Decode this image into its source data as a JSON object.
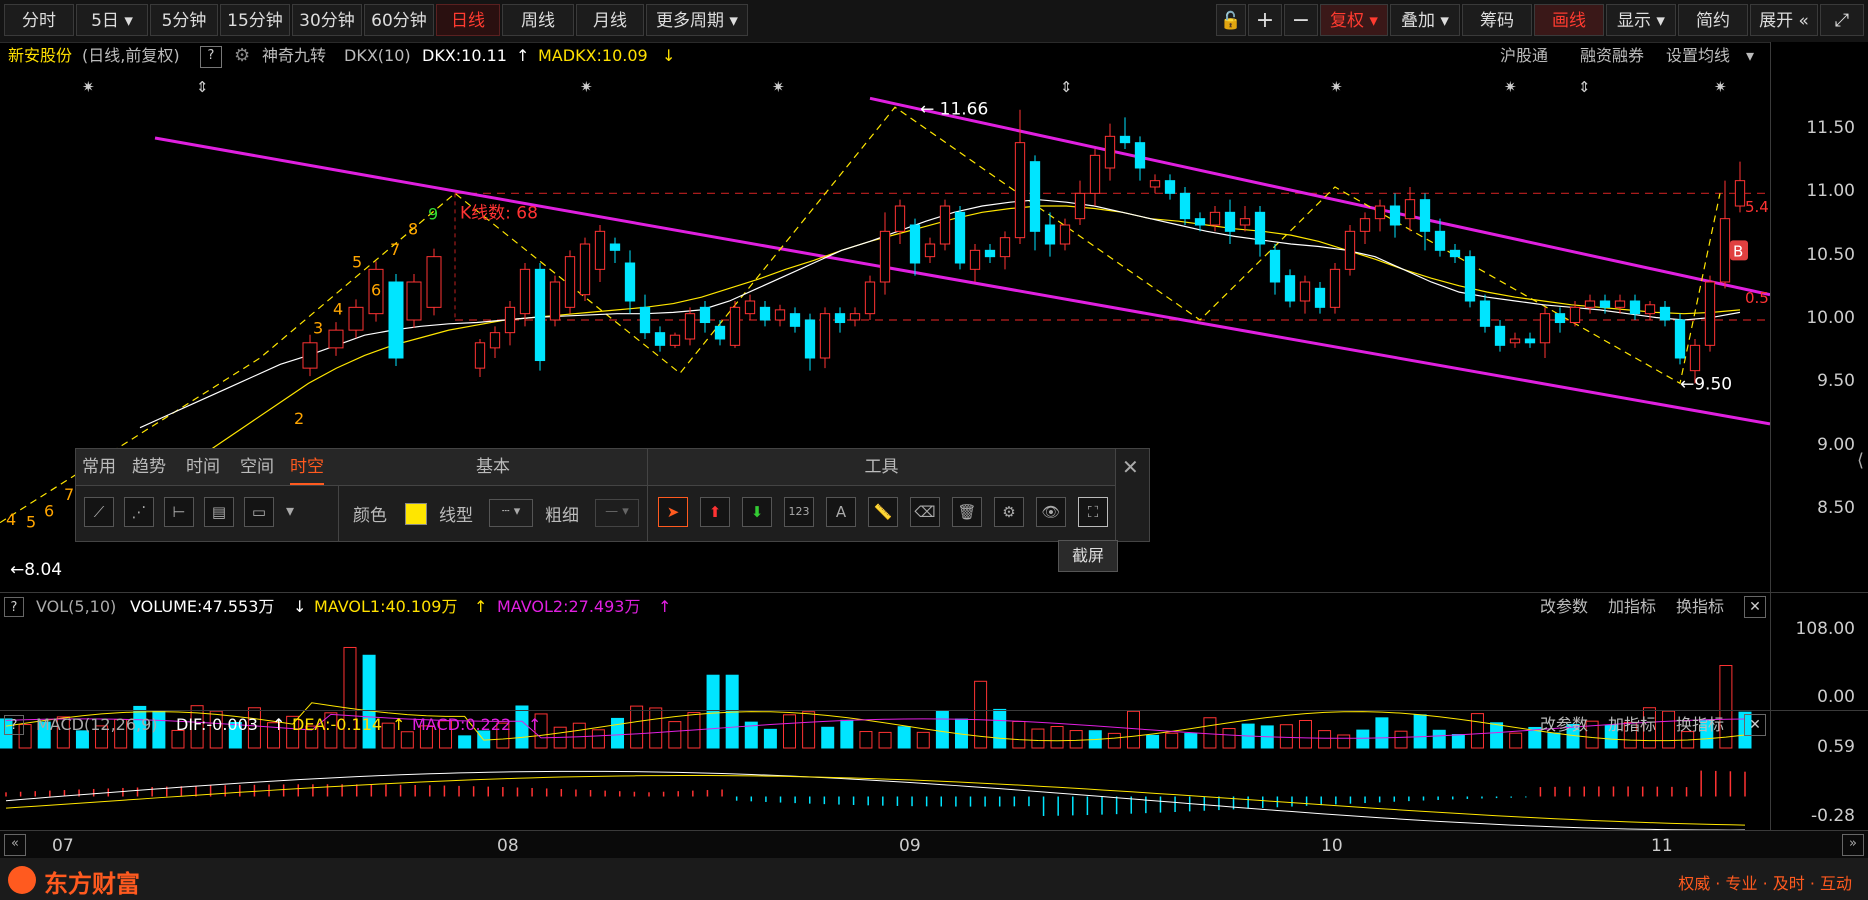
{
  "toolbar": {
    "buttons": [
      "分时",
      "5日",
      "5分钟",
      "15分钟",
      "30分钟",
      "60分钟",
      "日线",
      "周线",
      "月线",
      "更多周期"
    ],
    "right": [
      "复权",
      "叠加",
      "筹码",
      "画线",
      "显示",
      "简约",
      "展开"
    ]
  },
  "info": {
    "stock": "新安股份",
    "mode": "(日线,前复权)",
    "help": "?",
    "indicator": "神奇九转",
    "dkx_name": "DKX(10)",
    "dkx": "DKX:10.11",
    "madkx": "MADKX:10.09",
    "links": [
      "沪股通",
      "融资融券",
      "设置均线"
    ]
  },
  "chart_labels": {
    "high": "11.66",
    "low": "9.50",
    "low_left": "8.04",
    "kcount": "K线数: 68",
    "right_marker1": "5.4",
    "right_marker2": "0.5",
    "b_marker": "B"
  },
  "nine_turn": [
    "3",
    "4",
    "5",
    "6",
    "7",
    "8",
    "9"
  ],
  "nine_turn_left": [
    "4",
    "5",
    "6",
    "7",
    "2"
  ],
  "vol_header": {
    "name": "VOL(5,10)",
    "volume": "VOLUME:47.553万",
    "mavol1": "MAVOL1:40.109万",
    "mavol2": "MAVOL2:27.493万",
    "actions": [
      "改参数",
      "加指标",
      "换指标"
    ]
  },
  "macd_header": {
    "name": "MACD(12,26,9)",
    "dif": "DIF:-0.003",
    "dea": "DEA:-0.114",
    "macd": "MACD:0.222",
    "actions": [
      "改参数",
      "加指标",
      "换指标"
    ]
  },
  "tool_panel": {
    "tabs": [
      "常用",
      "趋势",
      "时间",
      "空间",
      "时空"
    ],
    "basic_title": "基本",
    "color_label": "颜色",
    "line_label": "线型",
    "width_label": "粗细",
    "tools_title": "工具",
    "tooltip": "截屏"
  },
  "footer": {
    "brand": "东方财富",
    "slogan": "权威 · 专业 · 及时 · 互动"
  },
  "colors": {
    "up": "#ff3333",
    "down": "#00e5ff",
    "ma1": "#ffffff",
    "ma2": "#ffe600",
    "trend": "#e020e0",
    "accent": "#ff3b30"
  },
  "chart_data": [
    {
      "type": "candlestick",
      "title": "新安股份",
      "x_ticks": [
        "07",
        "08",
        "09",
        "10",
        "11"
      ],
      "ylim": [
        8.0,
        11.9
      ],
      "yticks": [
        "11.50",
        "11.00",
        "10.50",
        "10.00",
        "9.50",
        "9.00",
        "8.50"
      ],
      "candles": [
        [
          9.62,
          9.82,
          9.55,
          9.85
        ],
        [
          9.78,
          9.9,
          9.7,
          9.95
        ],
        [
          9.9,
          10.1,
          9.8,
          10.15
        ],
        [
          10.05,
          10.4,
          9.95,
          10.45
        ],
        [
          10.4,
          9.68,
          9.6,
          10.45
        ],
        [
          10.0,
          10.3,
          9.95,
          10.35
        ],
        [
          10.1,
          10.5,
          10.05,
          10.55
        ],
        [
          10.2,
          10.6,
          10.15,
          10.65
        ],
        [
          10.4,
          10.7,
          10.3,
          10.75
        ],
        [
          10.6,
          10.55,
          10.45,
          10.65
        ],
        [
          10.45,
          10.15,
          10.05,
          10.55
        ],
        [
          10.1,
          9.9,
          9.85,
          10.2
        ],
        [
          9.9,
          9.8,
          9.75,
          9.95
        ],
        [
          9.8,
          9.88,
          9.78,
          9.9
        ],
        [
          9.85,
          10.05,
          9.8,
          10.1
        ],
        [
          10.1,
          9.98,
          9.9,
          10.15
        ],
        [
          9.95,
          9.85,
          9.8,
          10.0
        ],
        [
          9.8,
          10.1,
          9.78,
          10.15
        ],
        [
          10.05,
          10.15,
          10.0,
          10.2
        ],
        [
          10.1,
          10.0,
          9.95,
          10.15
        ],
        [
          10.0,
          10.08,
          9.95,
          10.12
        ],
        [
          10.05,
          9.95,
          9.9,
          10.1
        ],
        [
          10.0,
          9.7,
          9.6,
          10.05
        ],
        [
          9.7,
          10.05,
          9.62,
          10.1
        ],
        [
          10.05,
          9.98,
          9.9,
          10.1
        ],
        [
          10.0,
          10.05,
          9.95,
          10.1
        ],
        [
          10.05,
          10.3,
          10.0,
          10.35
        ],
        [
          10.3,
          10.7,
          10.2,
          10.85
        ],
        [
          10.7,
          10.9,
          10.6,
          10.95
        ],
        [
          10.75,
          10.45,
          10.35,
          10.8
        ],
        [
          10.5,
          10.6,
          10.45,
          10.65
        ],
        [
          10.6,
          10.9,
          10.55,
          10.95
        ],
        [
          10.85,
          10.45,
          10.4,
          10.9
        ],
        [
          10.4,
          10.55,
          10.3,
          10.6
        ],
        [
          10.55,
          10.5,
          10.45,
          10.6
        ],
        [
          10.5,
          10.65,
          10.4,
          10.7
        ],
        [
          10.65,
          11.4,
          10.6,
          11.66
        ],
        [
          11.25,
          10.7,
          10.55,
          11.3
        ],
        [
          10.75,
          10.6,
          10.5,
          10.85
        ],
        [
          10.6,
          10.75,
          10.55,
          10.8
        ],
        [
          10.8,
          11.0,
          10.75,
          11.1
        ],
        [
          11.0,
          11.3,
          10.9,
          11.35
        ],
        [
          11.2,
          11.45,
          11.1,
          11.55
        ],
        [
          11.45,
          11.4,
          11.35,
          11.6
        ],
        [
          11.4,
          11.2,
          11.1,
          11.45
        ],
        [
          11.05,
          11.1,
          11.0,
          11.15
        ],
        [
          11.1,
          11.0,
          10.95,
          11.15
        ],
        [
          11.0,
          10.8,
          10.75,
          11.05
        ],
        [
          10.8,
          10.75,
          10.7,
          10.85
        ],
        [
          10.75,
          10.85,
          10.7,
          10.9
        ],
        [
          10.85,
          10.7,
          10.6,
          10.95
        ],
        [
          10.75,
          10.8,
          10.7,
          10.9
        ],
        [
          10.85,
          10.6,
          10.5,
          10.9
        ],
        [
          10.55,
          10.3,
          10.2,
          10.6
        ],
        [
          10.35,
          10.15,
          10.1,
          10.4
        ],
        [
          10.15,
          10.3,
          10.05,
          10.35
        ],
        [
          10.25,
          10.1,
          10.05,
          10.3
        ],
        [
          10.1,
          10.4,
          10.05,
          10.45
        ],
        [
          10.4,
          10.7,
          10.35,
          10.75
        ],
        [
          10.7,
          10.8,
          10.6,
          10.85
        ],
        [
          10.8,
          10.9,
          10.7,
          10.95
        ],
        [
          10.9,
          10.75,
          10.65,
          11.0
        ],
        [
          10.8,
          10.95,
          10.7,
          11.05
        ],
        [
          10.95,
          10.7,
          10.55,
          11.0
        ],
        [
          10.7,
          10.55,
          10.5,
          10.8
        ],
        [
          10.55,
          10.5,
          10.45,
          10.6
        ],
        [
          10.5,
          10.15,
          10.1,
          10.55
        ],
        [
          10.15,
          9.95,
          9.9,
          10.2
        ],
        [
          9.95,
          9.8,
          9.75,
          10.0
        ],
        [
          9.82,
          9.85,
          9.78,
          9.9
        ],
        [
          9.85,
          9.82,
          9.78,
          9.9
        ],
        [
          9.82,
          10.05,
          9.7,
          10.1
        ],
        [
          10.05,
          9.98,
          9.9,
          10.1
        ],
        [
          9.98,
          10.1,
          9.95,
          10.15
        ],
        [
          10.1,
          10.15,
          10.05,
          10.2
        ],
        [
          10.15,
          10.1,
          10.05,
          10.2
        ],
        [
          10.1,
          10.15,
          10.05,
          10.2
        ],
        [
          10.15,
          10.05,
          10.0,
          10.2
        ],
        [
          10.05,
          10.12,
          10.0,
          10.15
        ],
        [
          10.1,
          10.0,
          9.95,
          10.15
        ],
        [
          10.0,
          9.7,
          9.65,
          10.05
        ],
        [
          9.6,
          9.8,
          9.5,
          9.85
        ],
        [
          9.8,
          10.3,
          9.75,
          10.35
        ],
        [
          10.3,
          10.8,
          10.25,
          11.1
        ],
        [
          10.9,
          11.1,
          10.85,
          11.25
        ]
      ],
      "ma_white": [
        9.15,
        9.25,
        9.35,
        9.45,
        9.55,
        9.65,
        9.72,
        9.8,
        9.88,
        9.92,
        9.95,
        9.97,
        9.98,
        10.0,
        10.02,
        10.03,
        10.04,
        10.05,
        10.05,
        10.06,
        10.08,
        10.15,
        10.25,
        10.35,
        10.45,
        10.55,
        10.62,
        10.7,
        10.78,
        10.85,
        10.9,
        10.93,
        10.95,
        10.93,
        10.9,
        10.85,
        10.8,
        10.75,
        10.7,
        10.66,
        10.63,
        10.6,
        10.58,
        10.55,
        10.5,
        10.4,
        10.3,
        10.22,
        10.18,
        10.15,
        10.12,
        10.1,
        10.08,
        10.05,
        10.02,
        10.0,
        10.02,
        10.06
      ],
      "ma_yellow": [
        8.6,
        8.75,
        8.9,
        9.05,
        9.2,
        9.35,
        9.5,
        9.62,
        9.72,
        9.8,
        9.86,
        9.92,
        9.96,
        10.0,
        10.02,
        10.04,
        10.06,
        10.08,
        10.1,
        10.13,
        10.18,
        10.25,
        10.32,
        10.4,
        10.47,
        10.55,
        10.62,
        10.68,
        10.74,
        10.8,
        10.85,
        10.88,
        10.9,
        10.9,
        10.88,
        10.85,
        10.8,
        10.78,
        10.75,
        10.72,
        10.7,
        10.67,
        10.62,
        10.55,
        10.48,
        10.4,
        10.33,
        10.27,
        10.22,
        10.18,
        10.15,
        10.12,
        10.1,
        10.08,
        10.06,
        10.05,
        10.06,
        10.08
      ]
    },
    {
      "type": "bar",
      "title": "VOL(5,10)",
      "ylim": [
        0,
        108
      ],
      "yticks": [
        "108.00",
        "0.00"
      ]
    },
    {
      "type": "bar",
      "title": "MACD(12,26,9)",
      "ylim": [
        -0.28,
        0.59
      ],
      "yticks": [
        "0.59",
        "-0.28"
      ]
    }
  ]
}
